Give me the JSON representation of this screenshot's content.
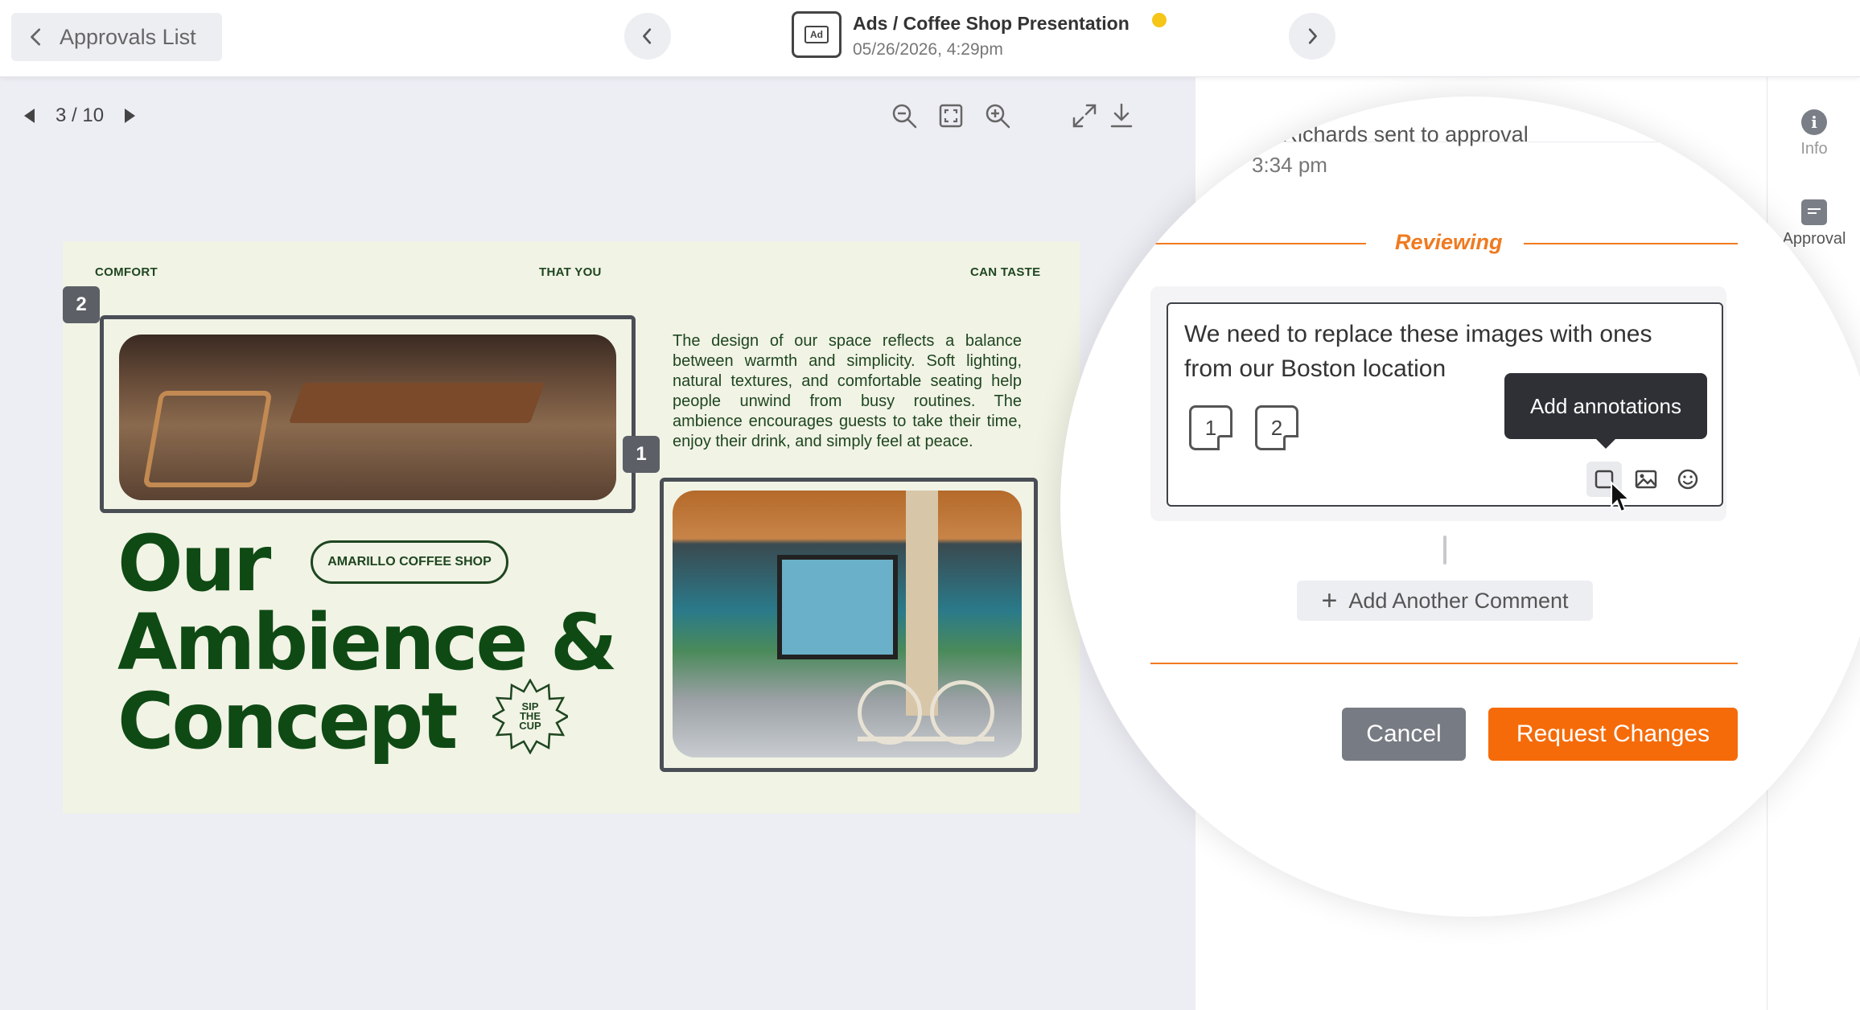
{
  "header": {
    "back_label": "Approvals List",
    "doc_icon_text": "Ad",
    "title": "Ads / Coffee Shop Presentation",
    "date": "05/26/2026, 4:29pm",
    "status_color": "#f5c518"
  },
  "viewer": {
    "page_indicator": "3 / 10"
  },
  "slide": {
    "head_left": "COMFORT",
    "head_center": "THAT YOU",
    "head_right": "CAN TASTE",
    "marker_1": "1",
    "marker_2": "2",
    "body_text": "The design of our space reflects a balance between warmth and simplicity. Soft lighting, natural textures, and comfortable seating help people unwind from busy routines. The ambience encourages guests to take their time, enjoy their drink, and simply feel at peace.",
    "title_line1": "Our",
    "title_line2": "Ambience &",
    "title_line3": "Concept",
    "pill_text": "AMARILLO COFFEE SHOP",
    "badge_line1": "SIP",
    "badge_line2": "THE",
    "badge_line3": "CUP"
  },
  "panel": {
    "activity_text": "na Richards sent to approval",
    "activity_time": "3:34 pm",
    "section_label": "Reviewing",
    "comment_text": "We need to replace these images with ones from our Boston location",
    "annotation_1": "1",
    "annotation_2": "2",
    "tooltip": "Add annotations",
    "add_comment_label": "Add Another Comment",
    "cancel_label": "Cancel",
    "request_label": "Request Changes",
    "accent_color": "#f07a20"
  },
  "rail": {
    "info_label": "Info",
    "approval_label": "Approval"
  }
}
